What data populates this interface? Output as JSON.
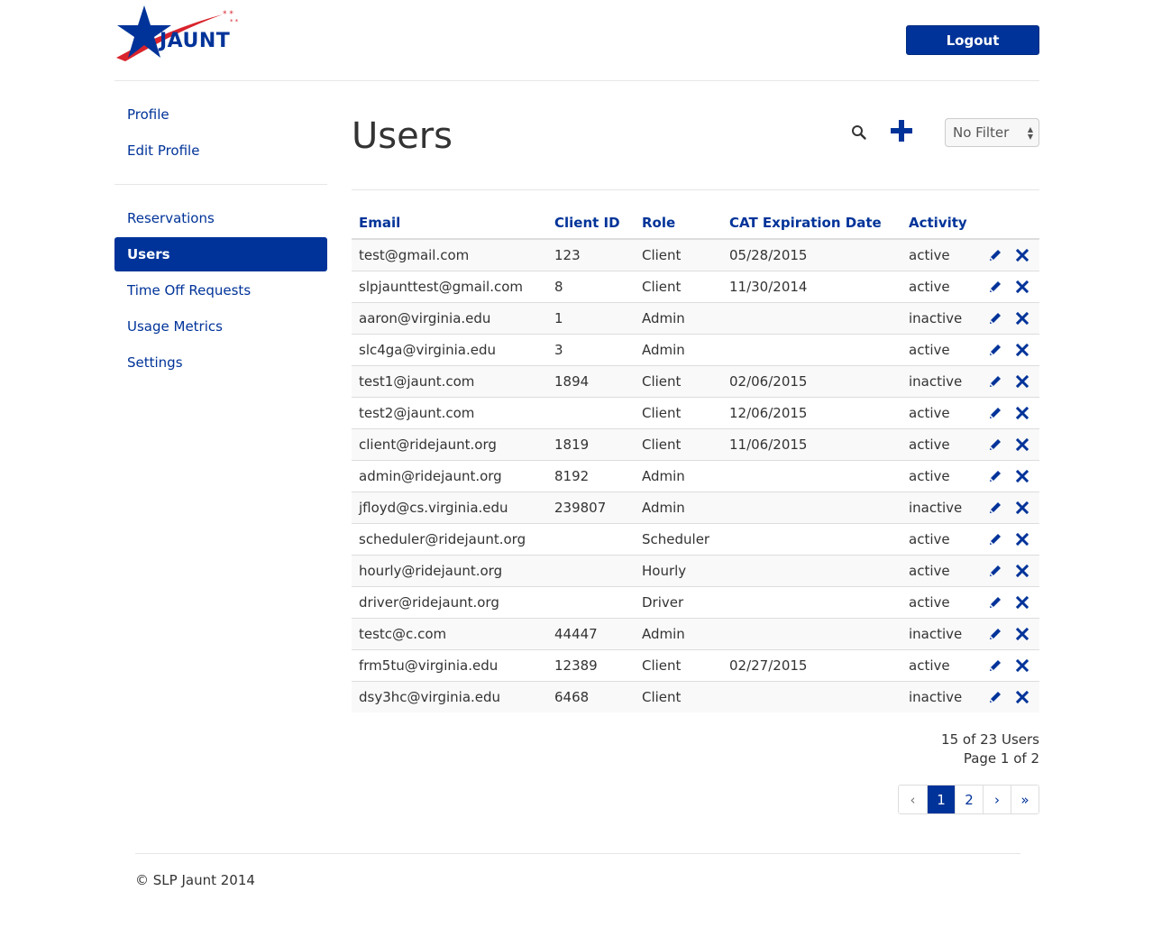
{
  "brand": {
    "logo_text": "JAUNT",
    "primary_color": "#003399",
    "accent_color": "#d9232d"
  },
  "header": {
    "logout_label": "Logout"
  },
  "sidebar": {
    "group1": [
      {
        "label": "Profile"
      },
      {
        "label": "Edit Profile"
      }
    ],
    "group2": [
      {
        "label": "Reservations"
      },
      {
        "label": "Users",
        "active": true
      },
      {
        "label": "Time Off Requests"
      },
      {
        "label": "Usage Metrics"
      },
      {
        "label": "Settings"
      }
    ]
  },
  "main": {
    "title": "Users",
    "search_icon": "search-icon",
    "add_icon": "plus-icon",
    "filter": {
      "selected": "No Filter"
    }
  },
  "table": {
    "headers": [
      "Email",
      "Client ID",
      "Role",
      "CAT Expiration Date",
      "Activity"
    ],
    "rows": [
      [
        "test@gmail.com",
        "123",
        "Client",
        "05/28/2015",
        "active"
      ],
      [
        "slpjaunttest@gmail.com",
        "8",
        "Client",
        "11/30/2014",
        "active"
      ],
      [
        "aaron@virginia.edu",
        "1",
        "Admin",
        "",
        "inactive"
      ],
      [
        "slc4ga@virginia.edu",
        "3",
        "Admin",
        "",
        "active"
      ],
      [
        "test1@jaunt.com",
        "1894",
        "Client",
        "02/06/2015",
        "inactive"
      ],
      [
        "test2@jaunt.com",
        "",
        "Client",
        "12/06/2015",
        "active"
      ],
      [
        "client@ridejaunt.org",
        "1819",
        "Client",
        "11/06/2015",
        "active"
      ],
      [
        "admin@ridejaunt.org",
        "8192",
        "Admin",
        "",
        "active"
      ],
      [
        "jfloyd@cs.virginia.edu",
        "239807",
        "Admin",
        "",
        "inactive"
      ],
      [
        "scheduler@ridejaunt.org",
        "",
        "Scheduler",
        "",
        "active"
      ],
      [
        "hourly@ridejaunt.org",
        "",
        "Hourly",
        "",
        "active"
      ],
      [
        "driver@ridejaunt.org",
        "",
        "Driver",
        "",
        "active"
      ],
      [
        "testc@c.com",
        "44447",
        "Admin",
        "",
        "inactive"
      ],
      [
        "frm5tu@virginia.edu",
        "12389",
        "Client",
        "02/27/2015",
        "active"
      ],
      [
        "dsy3hc@virginia.edu",
        "6468",
        "Client",
        "",
        "inactive"
      ]
    ],
    "row_actions": [
      "pencil-icon",
      "close-icon"
    ]
  },
  "summary": {
    "count": "15 of 23 Users",
    "page": "Page 1 of 2"
  },
  "pagination": {
    "prev": "‹",
    "pages": [
      "1",
      "2"
    ],
    "current": "1",
    "next": "›",
    "last": "»"
  },
  "footer": {
    "text": "© SLP Jaunt 2014"
  }
}
